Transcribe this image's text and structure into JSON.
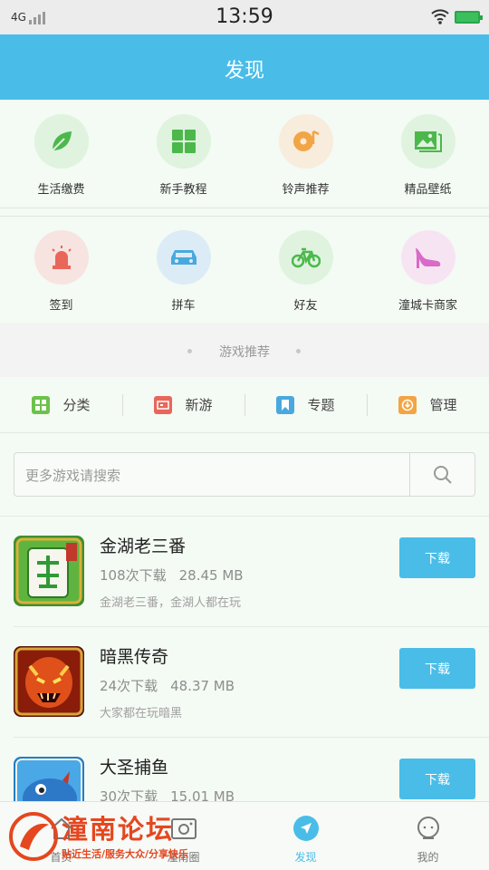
{
  "status": {
    "network": "4G",
    "time": "13:59"
  },
  "header": {
    "title": "发现"
  },
  "grid_row1": [
    {
      "label": "生活缴费",
      "icon": "leaf-icon",
      "bg": "#dff3df"
    },
    {
      "label": "新手教程",
      "icon": "apps-grid-icon",
      "bg": "#dff3df"
    },
    {
      "label": "铃声推荐",
      "icon": "music-disc-icon",
      "bg": "#f8ecdc"
    },
    {
      "label": "精品壁纸",
      "icon": "picture-icon",
      "bg": "#dff3df"
    }
  ],
  "grid_row2": [
    {
      "label": "签到",
      "icon": "alarm-light-icon",
      "bg": "#f7e4e0"
    },
    {
      "label": "拼车",
      "icon": "car-icon",
      "bg": "#dcecf6"
    },
    {
      "label": "好友",
      "icon": "bicycle-icon",
      "bg": "#dff3df"
    },
    {
      "label": "潼城卡商家",
      "icon": "high-heel-icon",
      "bg": "#f7e4f3"
    }
  ],
  "section": {
    "title": "游戏推荐"
  },
  "categories": [
    {
      "label": "分类",
      "icon": "category-icon",
      "color": "#6cc24a"
    },
    {
      "label": "新游",
      "icon": "new-game-icon",
      "color": "#e8665a"
    },
    {
      "label": "专题",
      "icon": "bookmark-icon",
      "color": "#49a9de"
    },
    {
      "label": "管理",
      "icon": "download-manage-icon",
      "color": "#f2a544"
    }
  ],
  "search": {
    "placeholder": "更多游戏请搜索"
  },
  "games": [
    {
      "name": "金湖老三番",
      "downloads": "108次下载",
      "size": "28.45 MB",
      "desc": "金湖老三番，金湖人都在玩",
      "button": "下载"
    },
    {
      "name": "暗黑传奇",
      "downloads": "24次下载",
      "size": "48.37 MB",
      "desc": "大家都在玩暗黑",
      "button": "下载"
    },
    {
      "name": "大圣捕鱼",
      "downloads": "30次下载",
      "size": "15.01 MB",
      "desc": "",
      "button": "下载"
    }
  ],
  "tabs": [
    {
      "label": "首页",
      "icon": "home-icon"
    },
    {
      "label": "潼南圈",
      "icon": "camera-circle-icon"
    },
    {
      "label": "发现",
      "icon": "discover-icon"
    },
    {
      "label": "我的",
      "icon": "profile-icon"
    }
  ],
  "watermark": {
    "text": "潼南论坛",
    "sub": "贴近生活/服务大众/分享快乐"
  },
  "colors": {
    "accent": "#49bde8",
    "background": "#f4faf4"
  }
}
